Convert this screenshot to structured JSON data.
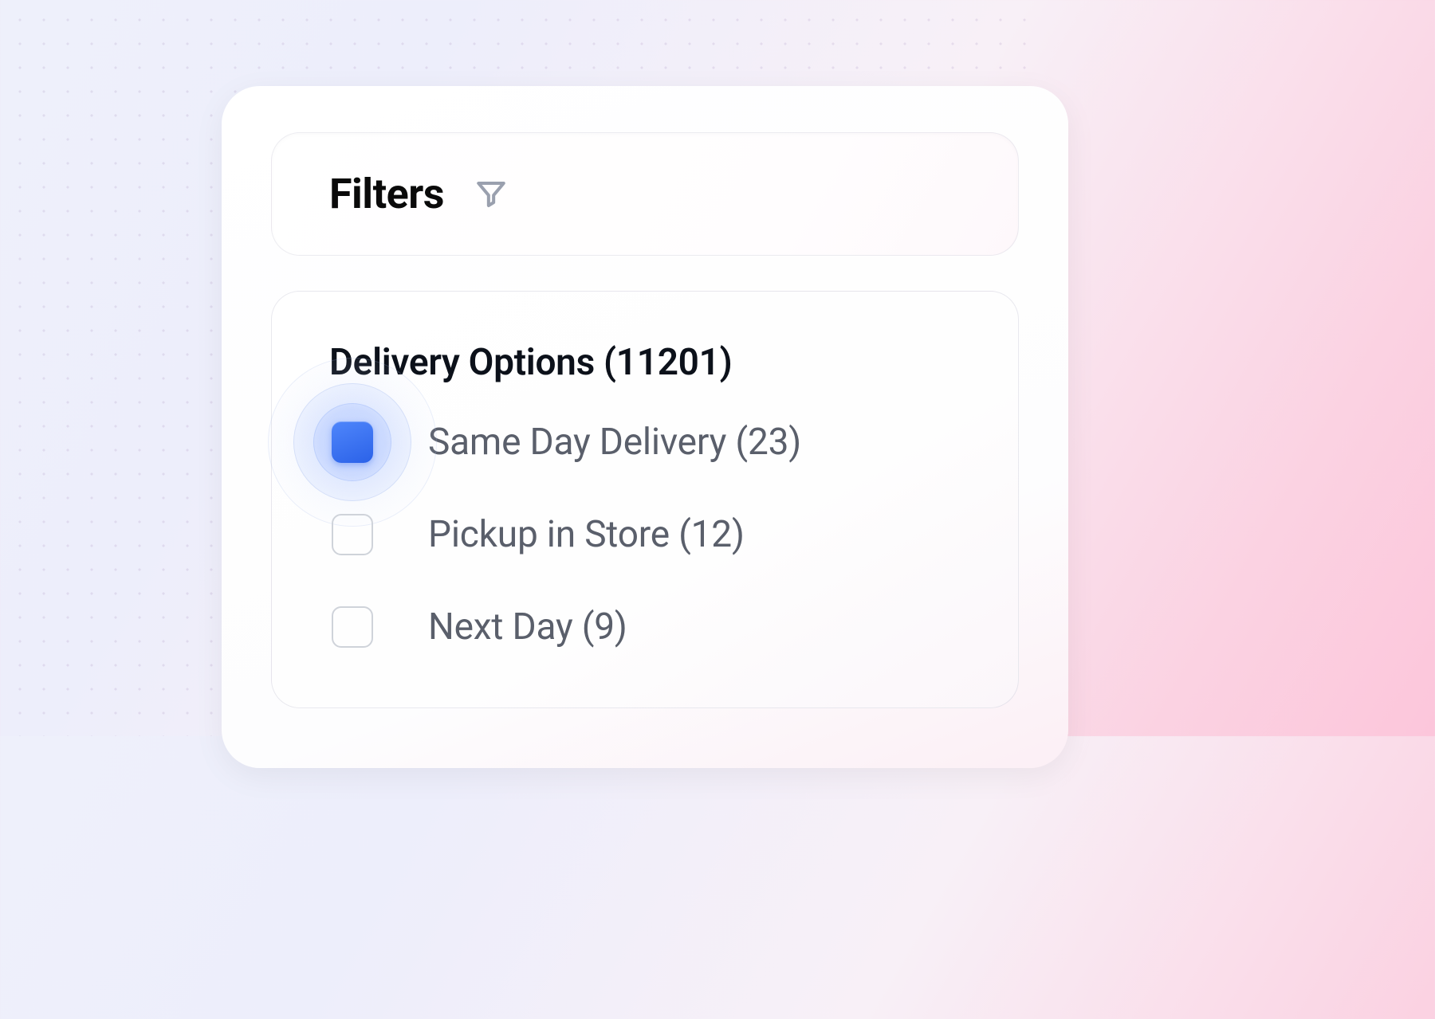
{
  "header": {
    "title": "Filters"
  },
  "section": {
    "title": "Delivery Options (11201)"
  },
  "options": [
    {
      "label": "Same Day Delivery (23)",
      "checked": true
    },
    {
      "label": "Pickup in Store (12)",
      "checked": false
    },
    {
      "label": "Next Day (9)",
      "checked": false
    }
  ]
}
